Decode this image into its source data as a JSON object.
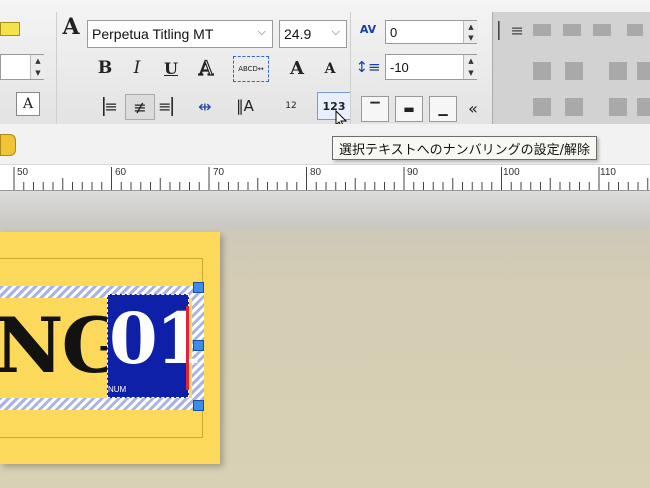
{
  "font": {
    "name": "Perpetua Titling MT",
    "size": "24.9"
  },
  "spacing": {
    "char_spacing": "0",
    "line_spacing": "-10"
  },
  "buttons": {
    "bold": "B",
    "italic": "I",
    "underline": "U",
    "outline": "A",
    "grow": "A",
    "shrink": "A",
    "numbering": "123",
    "collapse": "«",
    "small_12": "12"
  },
  "tooltip": "選択テキストへのナンバリングの設定/解除",
  "ruler": {
    "ticks": [
      "50",
      "60",
      "70",
      "80",
      "90",
      "100",
      "110"
    ]
  },
  "canvas": {
    "text_main": "NG",
    "text_number": "01",
    "number_tag": "NUM"
  },
  "colors": {
    "card": "#fcd95a",
    "selection": "#0e1fa8"
  }
}
